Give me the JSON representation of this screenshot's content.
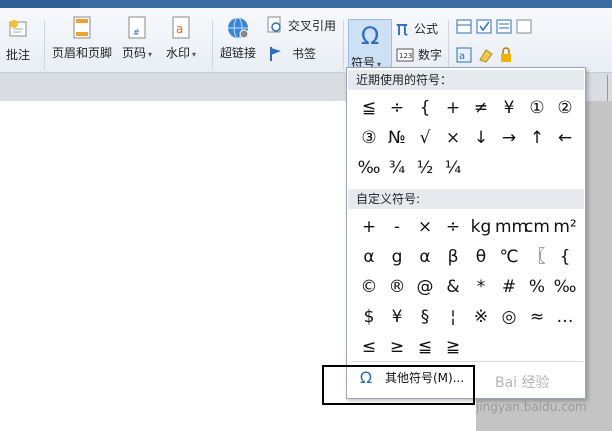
{
  "ribbon": {
    "comment": "批注",
    "header_footer": "页眉和页脚",
    "page_number": "页码",
    "watermark": "水印",
    "hyperlink": "超链接",
    "cross_ref": "交叉引用",
    "bookmark": "书签",
    "symbol": "符号",
    "formula": "公式",
    "number": "数字",
    "caret": "▾"
  },
  "dropdown": {
    "recent_title": "近期使用的符号：",
    "recent": [
      "≦",
      "÷",
      "{",
      "+",
      "≠",
      "¥",
      "①",
      "②",
      "③",
      "№",
      "√",
      "×",
      "↓",
      "→",
      "↑",
      "←",
      "‰",
      "¾",
      "½",
      "¼"
    ],
    "custom_title": "自定义符号:",
    "custom": [
      "+",
      "-",
      "×",
      "÷",
      "kg",
      "mm",
      "cm",
      "m²",
      "α",
      "g",
      "α",
      "β",
      "θ",
      "℃",
      "〖",
      "{",
      "©",
      "®",
      "@",
      "&",
      "*",
      "#",
      "%",
      "‰",
      "$",
      "¥",
      "§",
      "¦",
      "※",
      "◎",
      "≈",
      "…",
      "≤",
      "≥",
      "≦",
      "≧"
    ],
    "more_label": "其他符号(M)...",
    "more_icon": "Ω"
  },
  "watermark_text": {
    "line1": "Bai 经验",
    "line2": "jingyan.baidu.com"
  },
  "colors": {
    "accent": "#2f6fb5",
    "titlebar": "#3b6da3"
  }
}
